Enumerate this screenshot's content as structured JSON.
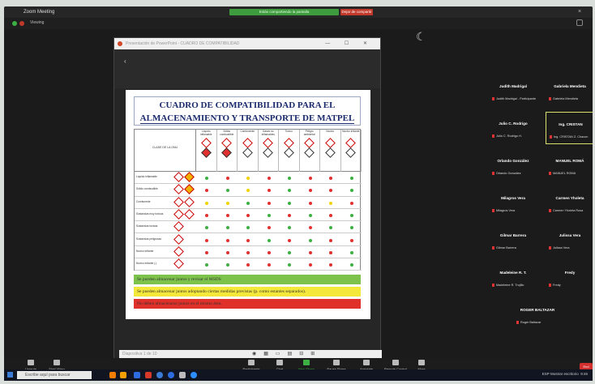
{
  "window": {
    "title": "Zoom Meeting",
    "share_status": "Estás compartiendo la pantalla",
    "stop_label": "Dejar de compartir"
  },
  "topbar": {
    "view_label": "Viewing"
  },
  "shared_window": {
    "title": "Presentación de PowerPoint - CUADRO DE COMPATIBILIDAD",
    "page_indicator": "Diapositiva 1 de 10"
  },
  "slide": {
    "title_line1": "CUADRO DE COMPATIBILIDAD PARA EL",
    "title_line2": "ALMACENAMIENTO Y TRANSPORTE DE MATPEL",
    "corner_label": "CLASE DE LA ONU",
    "columns": [
      "Líquido inflamable",
      "Sólido combustible",
      "Comburente",
      "Gases no inflamables",
      "Toxico",
      "Peligro ambiental",
      "Nocivo",
      "Nocivo irritante"
    ],
    "rows": [
      {
        "label": "Líquido inflamable",
        "dots": [
          "green",
          "red",
          "yellow",
          "red",
          "green",
          "red",
          "red",
          "green"
        ]
      },
      {
        "label": "Sólido combustible",
        "dots": [
          "red",
          "green",
          "yellow",
          "red",
          "green",
          "red",
          "red",
          "green"
        ]
      },
      {
        "label": "Comburente",
        "dots": [
          "yellow",
          "yellow",
          "green",
          "red",
          "green",
          "red",
          "yellow",
          "red"
        ]
      },
      {
        "label": "Sustancias muy toxicas",
        "dots": [
          "red",
          "red",
          "red",
          "green",
          "red",
          "green",
          "red",
          "green"
        ]
      },
      {
        "label": "Sustancias toxicas",
        "dots": [
          "green",
          "green",
          "green",
          "red",
          "green",
          "red",
          "green",
          "green"
        ]
      },
      {
        "label": "Sustancias peligrosas",
        "dots": [
          "red",
          "red",
          "red",
          "green",
          "red",
          "green",
          "red",
          "red"
        ]
      },
      {
        "label": "Nocivo irritante",
        "dots": [
          "red",
          "red",
          "red",
          "red",
          "green",
          "red",
          "red",
          "green"
        ]
      },
      {
        "label": "Nocivo irritante (-)",
        "dots": [
          "green",
          "green",
          "red",
          "red",
          "green",
          "red",
          "red",
          "green"
        ]
      }
    ],
    "legend": [
      {
        "text": "Se pueden almacenar juntos y revisar el MSDS",
        "color": "#7dc24b"
      },
      {
        "text": "Se pueden almacenar juntos adoptando ciertas medidas previstas (p. como estantes separados).",
        "color": "#f4e83a"
      },
      {
        "text": "No deben almacenarse juntos en el mismo área.",
        "color": "#e0302a"
      }
    ]
  },
  "participants": [
    {
      "name": "Judith Madrigal",
      "sub": "Judith Madrigal - Participante"
    },
    {
      "name": "Gabriela Mendieta",
      "sub": "Gabriela Mendieta"
    },
    {
      "name": "Julio C. Rodrigo",
      "sub": "Julio C. Rodrigo H."
    },
    {
      "name": "Ing. CRISTAN",
      "sub": "Ing. CRISTAN Z. Chacon"
    },
    {
      "name": "Orlando González",
      "sub": "Orlando González"
    },
    {
      "name": "MANUEL ROMÁ",
      "sub": "MANUEL ROMÁ"
    },
    {
      "name": "Milagros Vera",
      "sub": "Milagros Vera"
    },
    {
      "name": "Carmen Yholeta",
      "sub": "Carmen Yholeta Rosa"
    },
    {
      "name": "Gilmar Barrera",
      "sub": "Gilmar Barrera"
    },
    {
      "name": "Julissa Vera",
      "sub": "Julissa Vera"
    },
    {
      "name": "Madeleine R. T.",
      "sub": "Madeleine R. Trujillo"
    },
    {
      "name": "Fredy",
      "sub": "Fredy"
    },
    {
      "name": "ROGER BALTAZAR",
      "sub": "Roger Baltazar"
    }
  ],
  "toolbar": {
    "items": [
      "Unmute",
      "Start Video",
      "Participants",
      "Chat",
      "New Share",
      "Pause Share",
      "Annotate",
      "Remote Control",
      "More"
    ],
    "end_label": "End"
  },
  "taskbar": {
    "search_placeholder": "Escribe aquí para buscar",
    "time": "9:46",
    "tray_text": "ESP  Mostrar escritorio"
  }
}
